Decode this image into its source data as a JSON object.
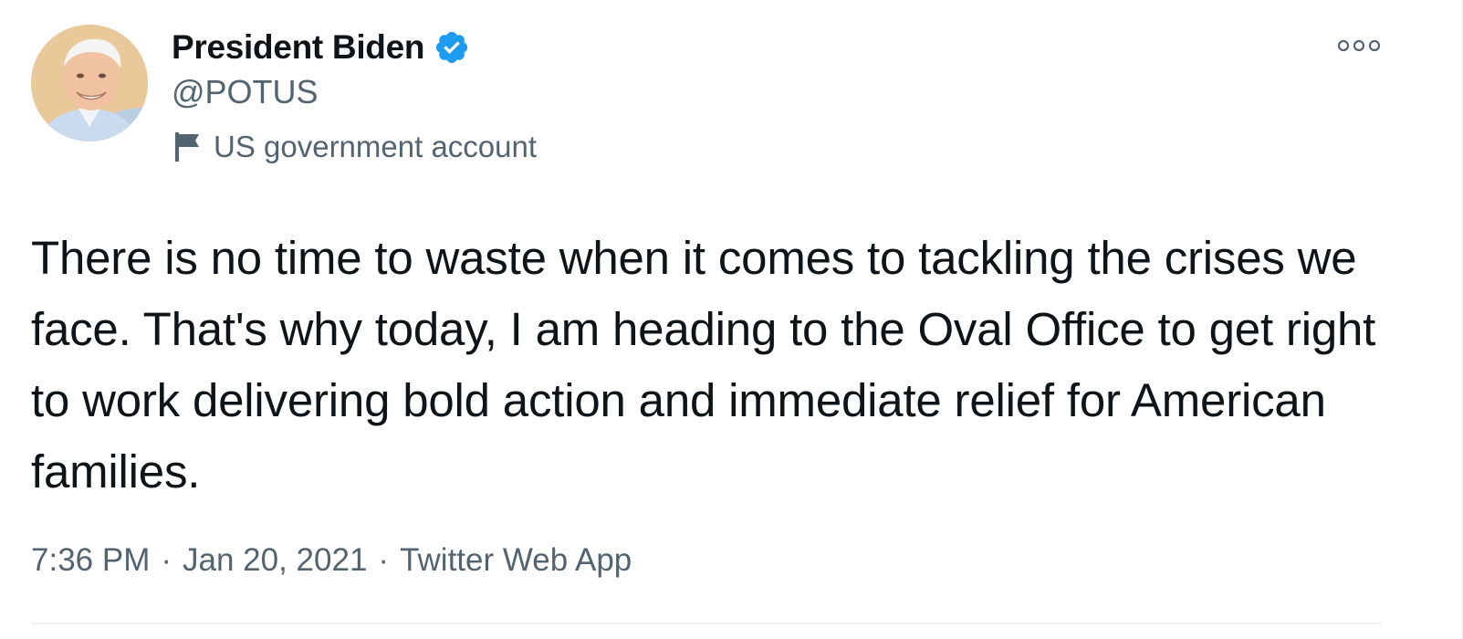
{
  "author": {
    "display_name": "President Biden",
    "handle": "@POTUS",
    "verified": true,
    "label_icon": "flag-icon",
    "label": "US government account"
  },
  "tweet": {
    "text": "There is no time to waste when it comes to tackling the crises we face. That's why today, I am heading to the Oval Office to get right to work delivering bold action and immediate relief for American families."
  },
  "meta": {
    "time": "7:36 PM",
    "separator": "·",
    "date": "Jan 20, 2021",
    "source": "Twitter Web App"
  },
  "icons": {
    "more": "more-icon",
    "verified": "verified-badge-icon",
    "label": "flag-icon"
  },
  "colors": {
    "text_primary": "#0f1419",
    "text_secondary": "#536471",
    "verified_blue": "#1d9bf0",
    "divider": "#eff3f4"
  }
}
